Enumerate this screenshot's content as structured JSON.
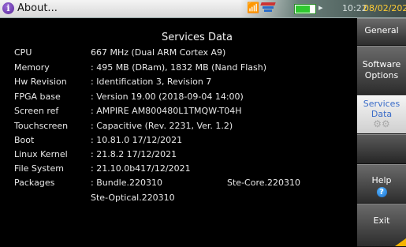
{
  "titlebar": {
    "title": "About...",
    "info_icon": "info-icon",
    "time": "10:22",
    "date": "08/02/2022"
  },
  "content": {
    "heading": "Services Data",
    "rows": [
      {
        "label": "CPU",
        "value": "667 MHz (Dual ARM Cortex A9)"
      },
      {
        "label": "Memory",
        "value": ": 495 MB (DRam), 1832 MB (Nand Flash)"
      },
      {
        "label": "Hw Revision",
        "value": ": Identification 3, Revision 7"
      },
      {
        "label": "FPGA base",
        "value": ": Version 19.00 (2018-09-04 14:00)"
      },
      {
        "label": "Screen ref",
        "value": ": AMPIRE AM800480L1TMQW-T04H"
      },
      {
        "label": "Touchscreen",
        "value": ": Capacitive  (Rev. 2231, Ver. 1.2)"
      },
      {
        "label": "Boot",
        "value": ": 10.81.0    17/12/2021"
      },
      {
        "label": "Linux Kernel",
        "value": ": 21.8.2     17/12/2021"
      },
      {
        "label": "File System",
        "value": ": 21.10.0b417/12/2021"
      },
      {
        "label": "Packages",
        "value": ": Bundle.220310",
        "value2": "Ste-Core.220310"
      },
      {
        "label": "",
        "value": "  Ste-Optical.220310"
      }
    ]
  },
  "sidebar": {
    "general": "General",
    "software_line1": "Software",
    "software_line2": "Options",
    "services_line1": "Services",
    "services_line2": "Data",
    "help": "Help",
    "exit": "Exit"
  }
}
